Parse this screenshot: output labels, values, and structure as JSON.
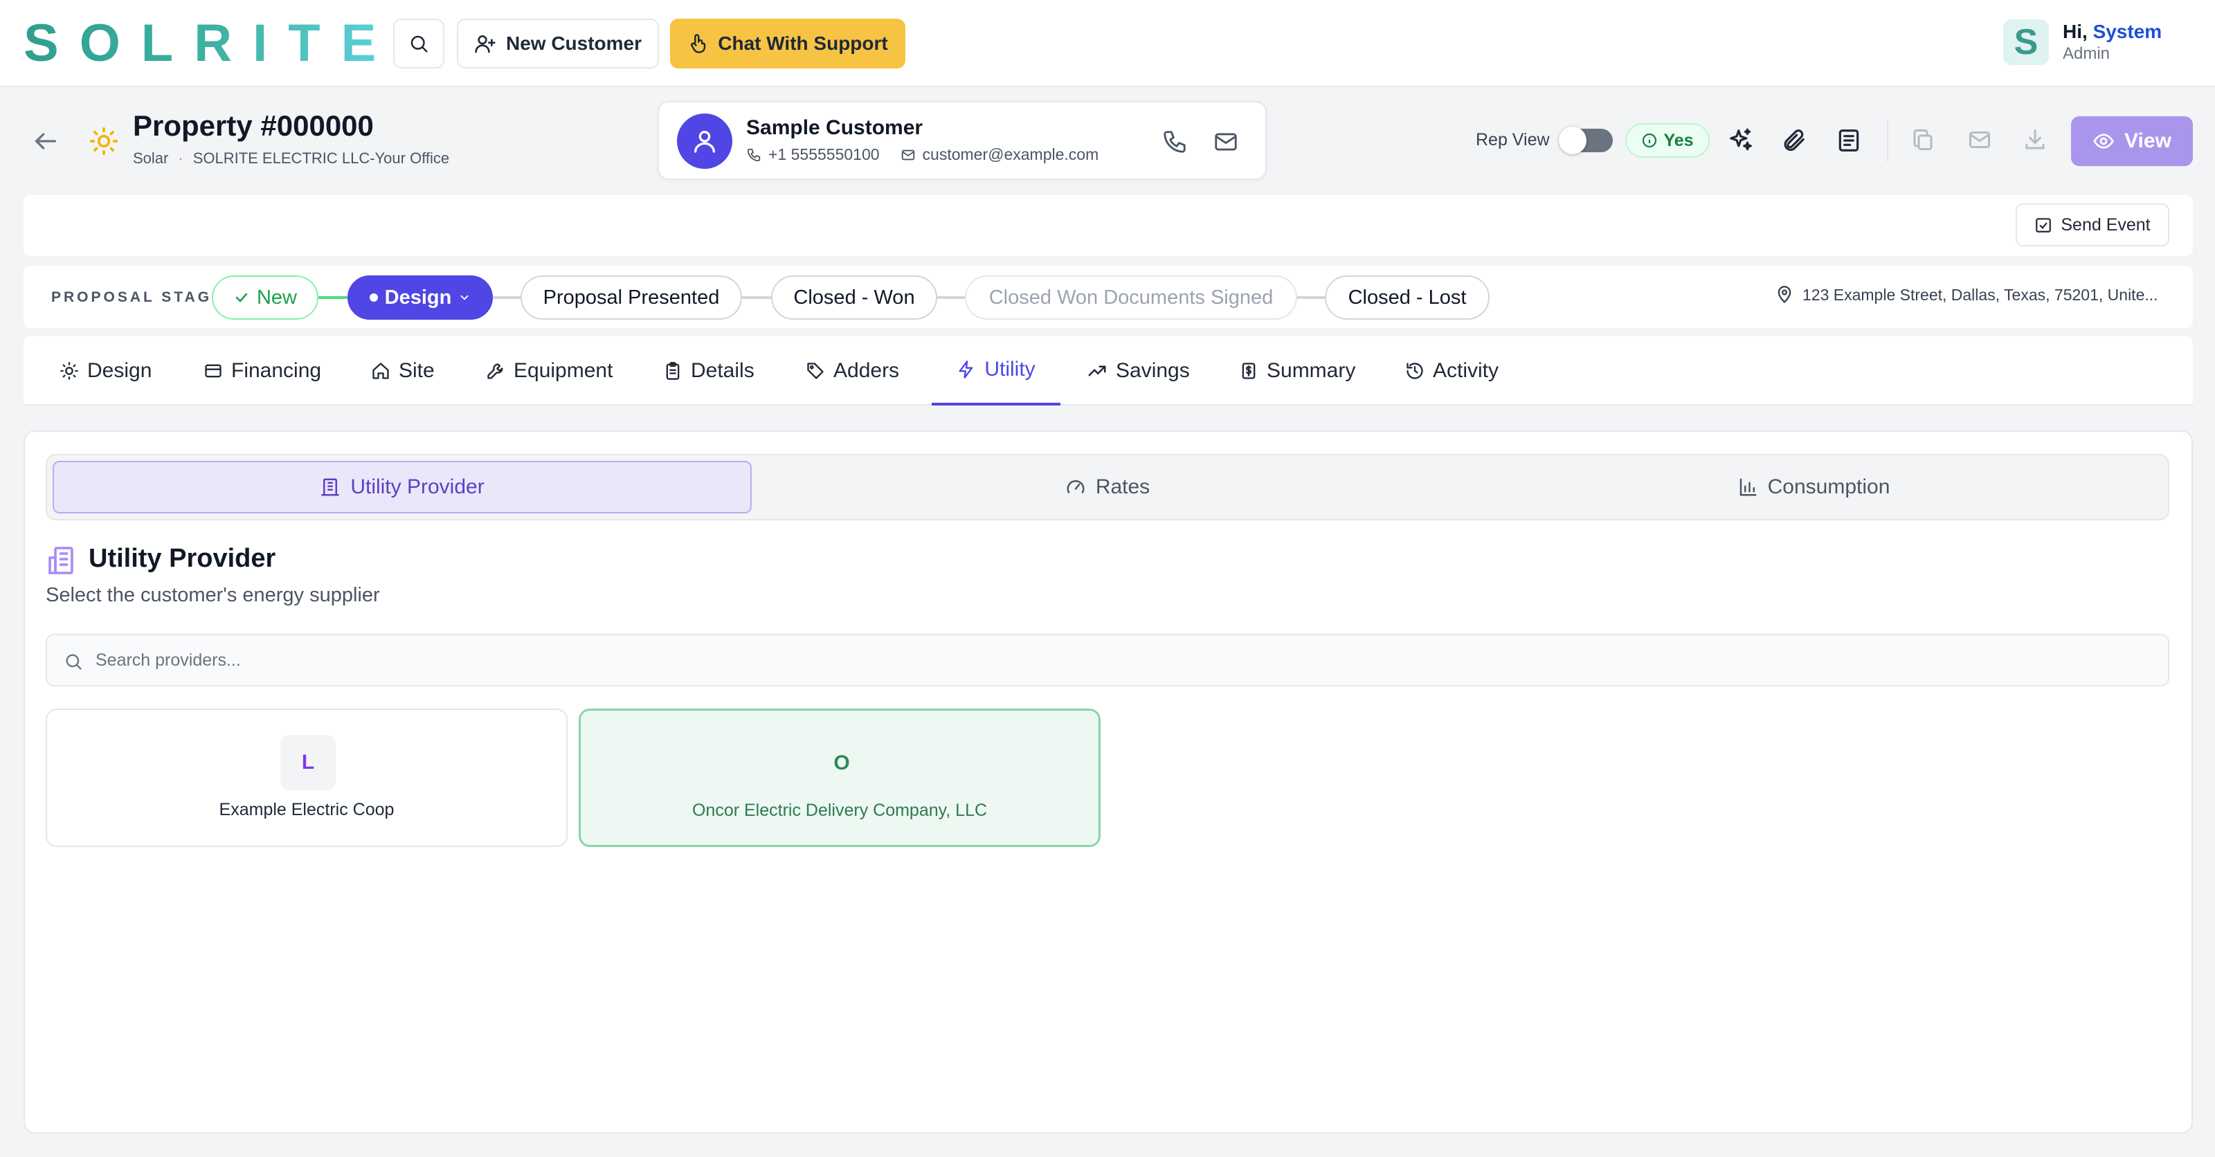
{
  "topnav": {
    "logo_text": "SOLRITE",
    "new_customer_label": "New Customer",
    "support_label": "Chat With Support",
    "user": {
      "avatar_letter": "S",
      "greeting_prefix": "Hi,",
      "name": "System",
      "role": "Admin"
    }
  },
  "property": {
    "title": "Property #000000",
    "type": "Solar",
    "office": "SOLRITE ELECTRIC LLC-Your Office"
  },
  "customer": {
    "name": "Sample Customer",
    "phone": "+1 5555550100",
    "email": "customer@example.com"
  },
  "header_actions": {
    "rep_view_label": "Rep View",
    "rep_view_on": false,
    "yes_badge": "Yes",
    "view_label": "View"
  },
  "event_bar": {
    "send_event_label": "Send Event"
  },
  "stages": {
    "label": "PROPOSAL STAGE",
    "items": [
      {
        "label": "New",
        "state": "complete"
      },
      {
        "label": "Design",
        "state": "current"
      },
      {
        "label": "Proposal Presented",
        "state": "pending"
      },
      {
        "label": "Closed - Won",
        "state": "pending"
      },
      {
        "label": "Closed Won Documents Signed",
        "state": "disabled"
      },
      {
        "label": "Closed - Lost",
        "state": "pending"
      }
    ],
    "address": "123 Example Street, Dallas, Texas, 75201, Unite..."
  },
  "tabs": [
    {
      "label": "Design"
    },
    {
      "label": "Financing"
    },
    {
      "label": "Site"
    },
    {
      "label": "Equipment"
    },
    {
      "label": "Details"
    },
    {
      "label": "Adders"
    },
    {
      "label": "Utility"
    },
    {
      "label": "Savings"
    },
    {
      "label": "Summary"
    },
    {
      "label": "Activity"
    }
  ],
  "active_tab": "Utility",
  "subtabs": [
    {
      "label": "Utility Provider"
    },
    {
      "label": "Rates"
    },
    {
      "label": "Consumption"
    }
  ],
  "section": {
    "title": "Utility Provider",
    "subtitle": "Select the customer's energy supplier",
    "search_placeholder": "Search providers..."
  },
  "providers": [
    {
      "letter": "L",
      "name": "Example Electric Coop",
      "selected": false
    },
    {
      "letter": "O",
      "name": "Oncor Electric Delivery Company, LLC",
      "selected": true
    }
  ],
  "colors": {
    "primary": "#4f46e5",
    "support": "#f6c343",
    "selected_green": "#86d6a8",
    "view_button": "#a996ec"
  }
}
